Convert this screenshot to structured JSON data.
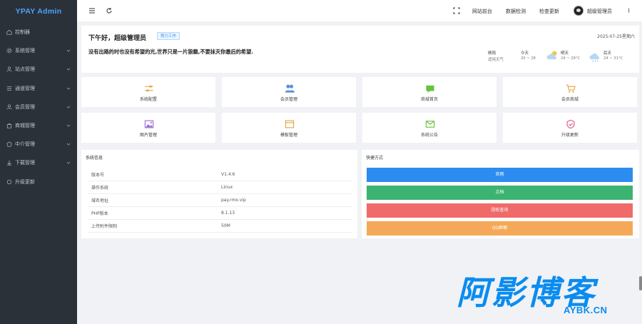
{
  "brand": "YPAY Admin",
  "colors": {
    "sidebar_bg": "#2b3139",
    "brand": "#4aa3ff",
    "accent": "#3a8ee6"
  },
  "sidebar": {
    "items": [
      {
        "label": "控制器",
        "icon": "home-icon",
        "has_children": false
      },
      {
        "label": "系统管理",
        "icon": "gear-icon",
        "has_children": true
      },
      {
        "label": "站点管理",
        "icon": "user-icon",
        "has_children": true
      },
      {
        "label": "通道管理",
        "icon": "list-icon",
        "has_children": true
      },
      {
        "label": "会员管理",
        "icon": "user-icon",
        "has_children": true
      },
      {
        "label": "商城管理",
        "icon": "shop-icon",
        "has_children": true
      },
      {
        "label": "中介管理",
        "icon": "badge-icon",
        "has_children": true
      },
      {
        "label": "下载管理",
        "icon": "download-icon",
        "has_children": true
      },
      {
        "label": "升级更新",
        "icon": "refresh-icon",
        "has_children": false
      }
    ]
  },
  "header": {
    "links": [
      "网站前台",
      "数据检测",
      "检查更新"
    ],
    "user": "超级管理员"
  },
  "welcome": {
    "greeting": "下午好，超级管理员",
    "badge": "努力工作",
    "date": "2025-07-25星期六",
    "quote": "没有出路的时也没有希望的光,世界只是一片狼籍,不要抹灭你最后的希望.",
    "weather_label": "晴雨",
    "weather_sub": "适用天气",
    "forecast": [
      {
        "day": "今天",
        "temp": "20 ~ 28"
      },
      {
        "day": "明天",
        "temp": "24 ~ 29°C"
      },
      {
        "day": "后天",
        "temp": "24 ~ 31°C"
      }
    ]
  },
  "tiles": [
    {
      "label": "系统配置",
      "icon": "sliders-icon",
      "color": "#e6a23c"
    },
    {
      "label": "会员管理",
      "icon": "users-icon",
      "color": "#5b8fd9"
    },
    {
      "label": "商城首页",
      "icon": "message-icon",
      "color": "#67c23a"
    },
    {
      "label": "会员商城",
      "icon": "cart-icon",
      "color": "#e6a23c"
    },
    {
      "label": "图片管理",
      "icon": "image-icon",
      "color": "#9b6bd6"
    },
    {
      "label": "模板管理",
      "icon": "window-icon",
      "color": "#e6a23c"
    },
    {
      "label": "系统公告",
      "icon": "mail-icon",
      "color": "#67c23a"
    },
    {
      "label": "升级更新",
      "icon": "shield-icon",
      "color": "#e05a8a"
    }
  ],
  "system": {
    "title": "系统信息",
    "rows": [
      {
        "key": "版本号",
        "value": "V1.4.6"
      },
      {
        "key": "操作系统",
        "value": "Linux"
      },
      {
        "key": "域名地址",
        "value": "pay.rmx.vip"
      },
      {
        "key": "PHP版本",
        "value": "8.1.13"
      },
      {
        "key": "上传附件限制",
        "value": "50M"
      }
    ]
  },
  "quick": {
    "title": "快捷方式",
    "buttons": [
      {
        "label": "官网",
        "color": "#2d8cf0"
      },
      {
        "label": "文档",
        "color": "#3cb371"
      },
      {
        "label": "授权查询",
        "color": "#f06a6a"
      },
      {
        "label": "QQ群聊",
        "color": "#f5a958"
      }
    ]
  },
  "watermark": {
    "cn": "阿影博客",
    "en": "AYBK.CN"
  }
}
